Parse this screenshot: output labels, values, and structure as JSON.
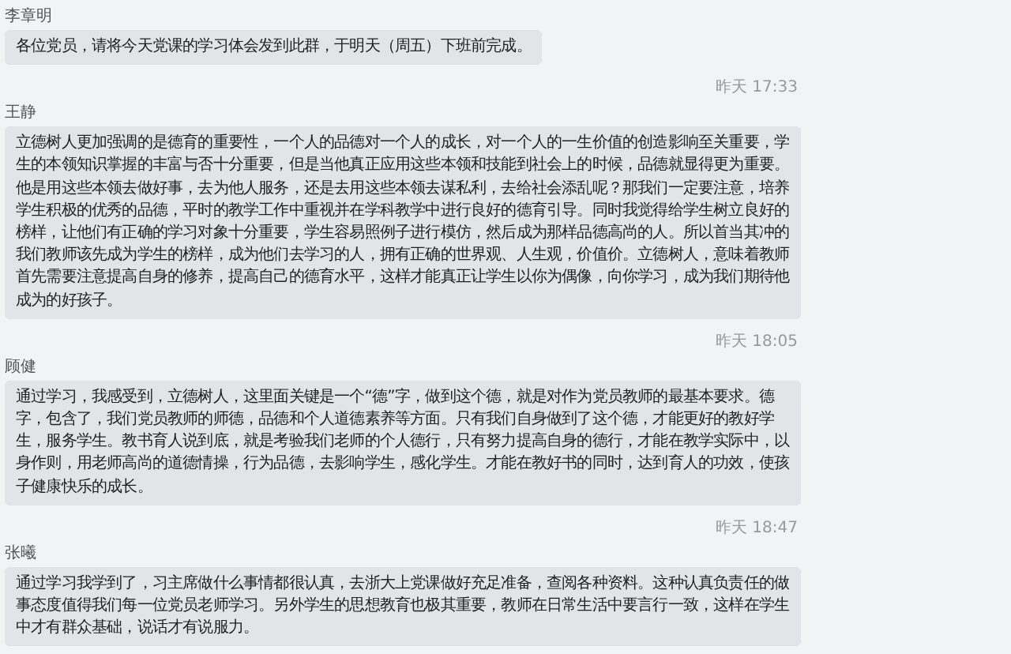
{
  "messages": [
    {
      "sender": "李章明",
      "text": "各位党员，请将今天党课的学习体会发到此群，于明天（周五）下班前完成。"
    },
    {
      "sender": "王静",
      "time": "昨天 17:33",
      "text": "立德树人更加强调的是德育的重要性，一个人的品德对一个人的成长，对一个人的一生价值的创造影响至关重要，学生的本领知识掌握的丰富与否十分重要，但是当他真正应用这些本领和技能到社会上的时候，品德就显得更为重要。他是用这些本领去做好事，去为他人服务，还是去用这些本领去谋私利，去给社会添乱呢？那我们一定要注意，培养学生积极的优秀的品德，平时的教学工作中重视并在学科教学中进行良好的德育引导。同时我觉得给学生树立良好的榜样，让他们有正确的学习对象十分重要，学生容易照例子进行模仿，然后成为那样品德高尚的人。所以首当其冲的我们教师该先成为学生的榜样，成为他们去学习的人，拥有正确的世界观、人生观，价值价。立德树人，意味着教师首先需要注意提高自身的修养，提高自己的德育水平，这样才能真正让学生以你为偶像，向你学习，成为我们期待他成为的好孩子。"
    },
    {
      "sender": "顾健",
      "time": "昨天 18:05",
      "text": "通过学习，我感受到，立德树人，这里面关键是一个“德”字，做到这个德，就是对作为党员教师的最基本要求。德字，包含了，我们党员教师的师德，品德和个人道德素养等方面。只有我们自身做到了这个德，才能更好的教好学生，服务学生。教书育人说到底，就是考验我们老师的个人德行，只有努力提高自身的德行，才能在教学实际中，以身作则，用老师高尚的道德情操，行为品德，去影响学生，感化学生。才能在教好书的同时，达到育人的功效，使孩子健康快乐的成长。"
    },
    {
      "sender": "张曦",
      "time": "昨天 18:47",
      "text": "通过学习我学到了，习主席做什么事情都很认真，去浙大上党课做好充足准备，查阅各种资料。这种认真负责任的做事态度值得我们每一位党员老师学习。另外学生的思想教育也极其重要，教师在日常生活中要言行一致，这样在学生中才有群众基础，说话才有说服力。"
    }
  ]
}
